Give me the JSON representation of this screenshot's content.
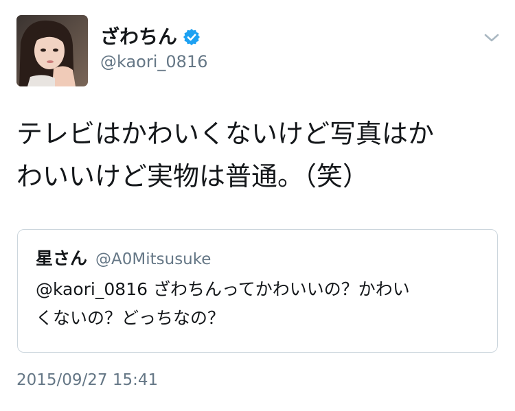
{
  "tweet": {
    "author": {
      "display_name": "ざわちん",
      "handle": "@kaori_0816",
      "verified": true,
      "avatar_icon": "profile-photo"
    },
    "menu_icon": "chevron-down-icon",
    "text": "テレビはかわいくないけど写真はか\nわいいけど実物は普通。（笑）",
    "timestamp": "2015/09/27 15:41"
  },
  "quoted_tweet": {
    "display_name": "星さん",
    "handle": "@A0Mitsusuke",
    "text": "@kaori_0816 ざわちんってかわいいの？かわい\nくないの？どっちなの？"
  },
  "colors": {
    "primary_text": "#14171a",
    "secondary_text": "#657786",
    "verified_blue": "#1da1f2",
    "card_border": "#ccd6dd",
    "chevron": "#aab8c2"
  }
}
